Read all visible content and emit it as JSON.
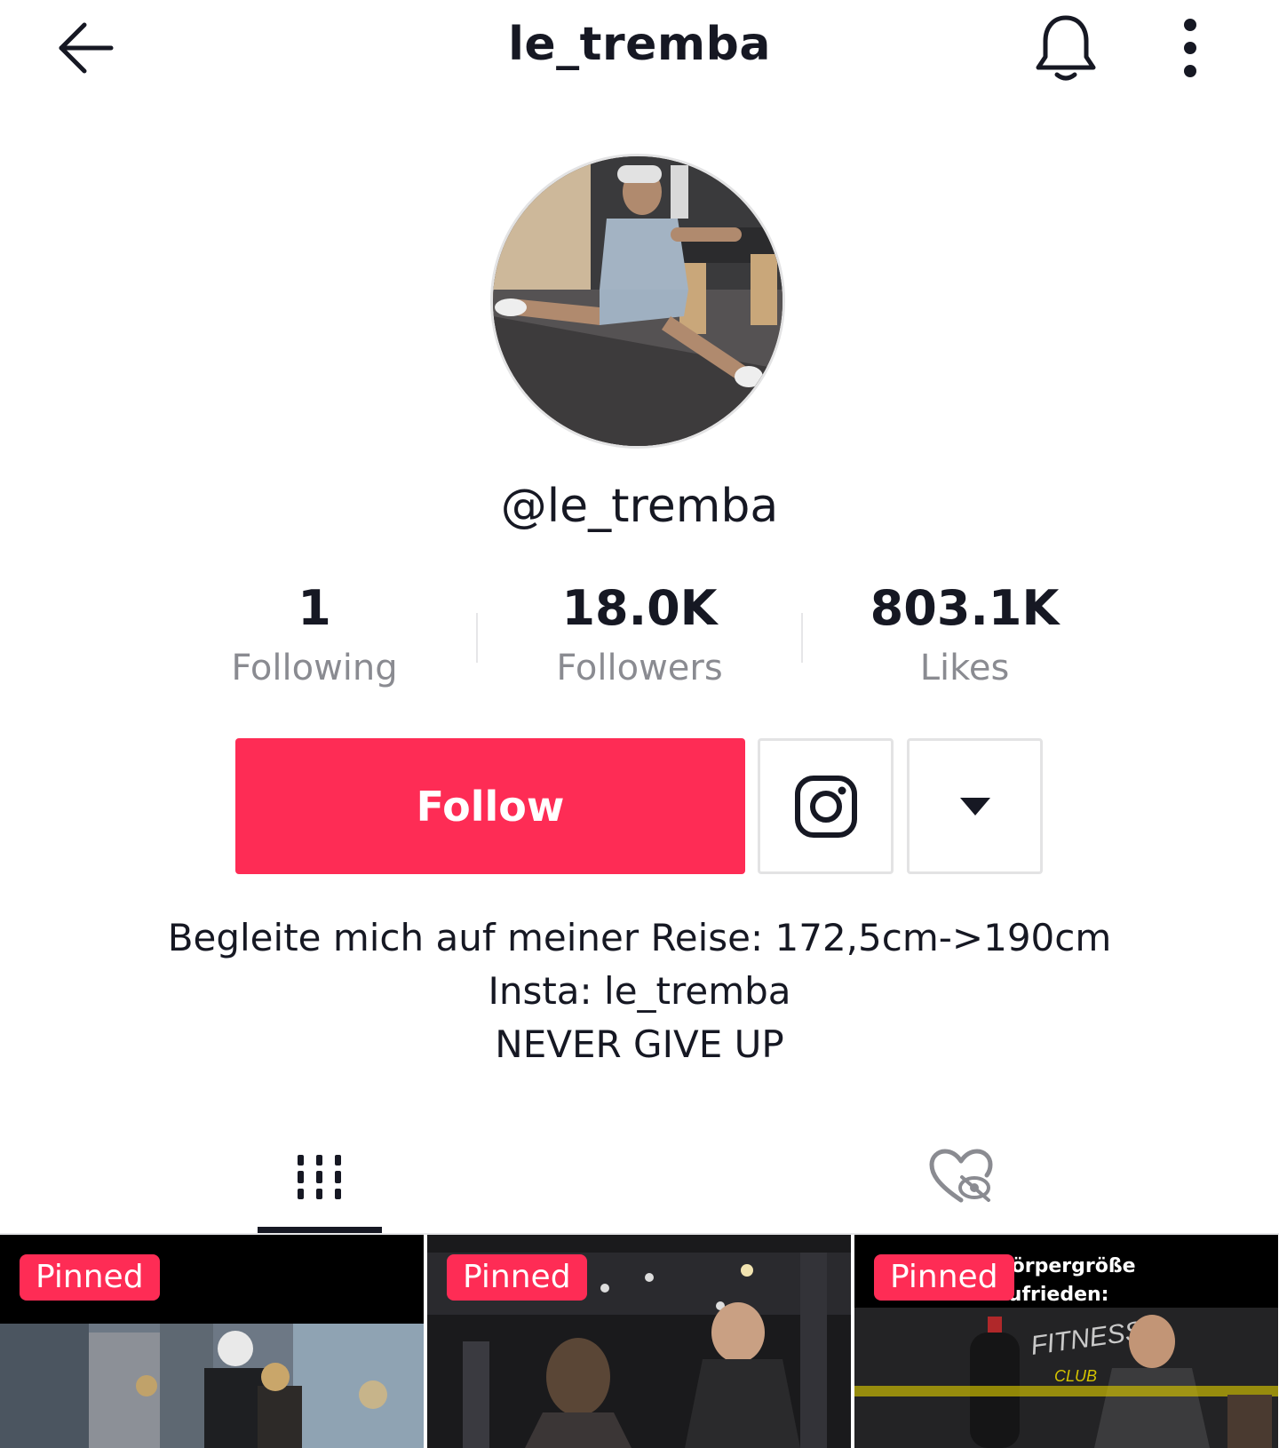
{
  "header": {
    "title": "le_tremba",
    "back_icon": "arrow-left-icon",
    "bell_icon": "bell-icon",
    "more_icon": "more-vertical-icon"
  },
  "profile": {
    "username": "@le_tremba",
    "avatar_description": "avatar-photo"
  },
  "stats": [
    {
      "value": "1",
      "label": "Following"
    },
    {
      "value": "18.0K",
      "label": "Followers"
    },
    {
      "value": "803.1K",
      "label": "Likes"
    }
  ],
  "actions": {
    "follow_label": "Follow",
    "instagram_icon": "instagram-icon",
    "dropdown_icon": "caret-down-icon"
  },
  "bio": {
    "lines": [
      "Begleite mich auf meiner Reise: 172,5cm->190cm",
      "Insta: le_tremba",
      "NEVER GIVE UP"
    ]
  },
  "tabs": [
    {
      "icon": "videos-grid-icon",
      "active": true
    },
    {
      "icon": "liked-hidden-icon",
      "active": false
    }
  ],
  "videos": [
    {
      "badge": "Pinned",
      "overlay": ""
    },
    {
      "badge": "Pinned",
      "overlay": ""
    },
    {
      "badge": "Pinned",
      "overlay_lines": [
        "Körpergröße",
        "zufrieden:"
      ]
    }
  ],
  "colors": {
    "accent": "#fe2c55",
    "text_primary": "#161823",
    "text_secondary": "#8a8b91",
    "border": "#e3e3e4"
  }
}
